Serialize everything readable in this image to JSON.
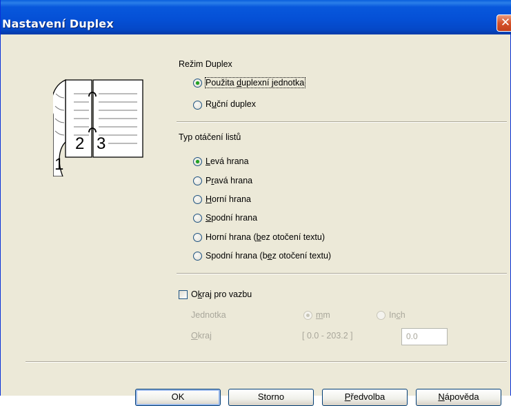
{
  "window": {
    "title": "Nastavení Duplex",
    "close_symbol": "✕"
  },
  "duplex_mode": {
    "group_label": "Režim Duplex",
    "options": [
      {
        "pre": "Použita ",
        "ul": "d",
        "post": "uplexní jednotka",
        "selected": true
      },
      {
        "pre": "R",
        "ul": "u",
        "post": "ční duplex",
        "selected": false
      }
    ]
  },
  "illustration": {
    "page_left": "2",
    "page_right": "3",
    "page_front": "1"
  },
  "turn_type": {
    "group_label": "Typ otáčení listů",
    "options": [
      {
        "pre": "",
        "ul": "L",
        "post": "evá hrana",
        "selected": true
      },
      {
        "pre": "P",
        "ul": "r",
        "post": "avá hrana",
        "selected": false
      },
      {
        "pre": "",
        "ul": "H",
        "post": "orní hrana",
        "selected": false
      },
      {
        "pre": "",
        "ul": "S",
        "post": "podní hrana",
        "selected": false
      },
      {
        "pre": "Horní hrana (",
        "ul": "b",
        "post": "ez otočení textu)",
        "selected": false
      },
      {
        "pre": "Spodní hrana (b",
        "ul": "e",
        "post": "z otočení textu)",
        "selected": false
      }
    ]
  },
  "binding_offset": {
    "checkbox_pre": "O",
    "checkbox_ul": "k",
    "checkbox_post": "raj pro vazbu",
    "checked": false,
    "unit_label": "Jednotka",
    "unit_mm_ul": "m",
    "unit_mm_post": "m",
    "unit_inch_pre": "In",
    "unit_inch_ul": "c",
    "unit_inch_post": "h",
    "unit_selected": "mm",
    "margin_ul": "O",
    "margin_post": "kraj",
    "range": "[ 0.0 - 203.2 ]",
    "value": "0.0"
  },
  "buttons": {
    "ok": "OK",
    "cancel": "Storno",
    "defaults_ul": "P",
    "defaults_post": "ředvolba",
    "help_ul": "N",
    "help_post": "ápověda"
  },
  "colors": {
    "titlebar": "#0550d6",
    "dialog_bg": "#ece9d8",
    "radio_selected": "#21a121",
    "close_button": "#d5512a"
  }
}
